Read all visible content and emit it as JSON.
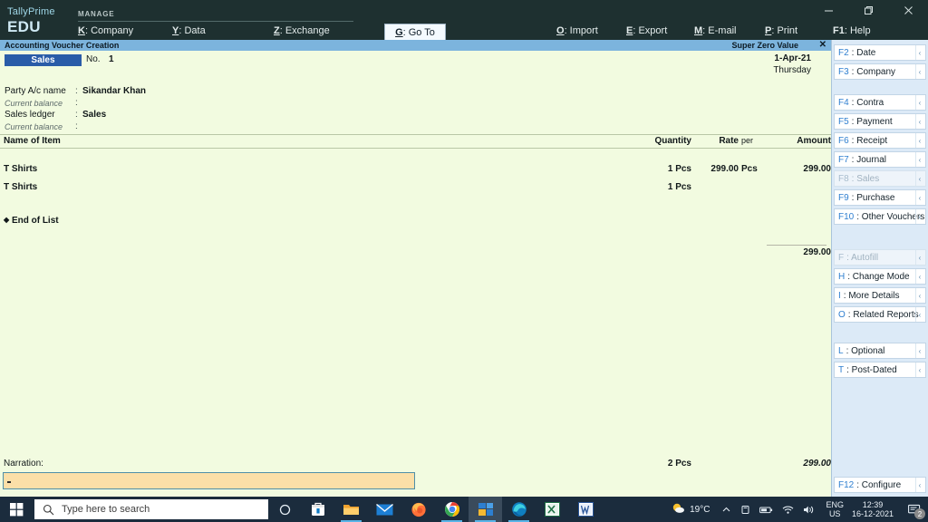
{
  "window": {
    "minimize_icon": "minimize-icon",
    "maximize_icon": "restore-icon",
    "close_icon": "close-icon"
  },
  "brand": {
    "product": "TallyPrime",
    "edition": "EDU"
  },
  "topmenu": {
    "group_label": "MANAGE",
    "items": [
      {
        "key": "K",
        "label": ": Company"
      },
      {
        "key": "Y",
        "label": ": Data"
      },
      {
        "key": "Z",
        "label": ": Exchange"
      }
    ],
    "goto": {
      "key": "G",
      "label": ": Go To"
    },
    "right_items": [
      {
        "key": "O",
        "label": ": Import"
      },
      {
        "key": "E",
        "label": ": Export"
      },
      {
        "key": "M",
        "label": ": E-mail"
      },
      {
        "key": "P",
        "label": ": Print"
      },
      {
        "key": "F1",
        "label": ": Help"
      }
    ]
  },
  "titlestrip": {
    "left": "Accounting Voucher Creation",
    "right": "Super Zero Value",
    "close": "✕"
  },
  "voucher": {
    "type": "Sales",
    "number_label": "No.",
    "number_value": "1",
    "date": "1-Apr-21",
    "weekday": "Thursday",
    "fields": [
      {
        "label": "Party A/c name",
        "colon": ":",
        "value": "Sikandar Khan",
        "italic": false
      },
      {
        "label": "Current balance",
        "colon": ":",
        "value": "",
        "italic": true
      },
      {
        "label": "Sales ledger",
        "colon": ":",
        "value": "Sales",
        "italic": false
      },
      {
        "label": "Current balance",
        "colon": ":",
        "value": "",
        "italic": true
      }
    ]
  },
  "grid": {
    "headers": {
      "item": "Name of Item",
      "quantity": "Quantity",
      "rate": "Rate",
      "per": "per",
      "amount": "Amount"
    },
    "rows": [
      {
        "name": "T Shirts",
        "quantity": "1 Pcs",
        "rate": "299.00",
        "per": "Pcs",
        "amount": "299.00"
      },
      {
        "name": "T Shirts",
        "quantity": "1 Pcs",
        "rate": "",
        "per": "",
        "amount": ""
      }
    ],
    "subtotal": "299.00",
    "end_of_list": "End of List"
  },
  "totals": {
    "quantity": "2 Pcs",
    "amount": "299.00"
  },
  "narration": {
    "label": "Narration:",
    "value": ""
  },
  "sidebar": {
    "groups": [
      {
        "items": [
          {
            "key": "F2",
            "label": ": Date",
            "disabled": false
          },
          {
            "key": "F3",
            "label": ": Company",
            "disabled": false
          }
        ]
      },
      {
        "items": [
          {
            "key": "F4",
            "label": ": Contra",
            "disabled": false
          },
          {
            "key": "F5",
            "label": ": Payment",
            "disabled": false
          },
          {
            "key": "F6",
            "label": ": Receipt",
            "disabled": false
          },
          {
            "key": "F7",
            "label": ": Journal",
            "disabled": false
          },
          {
            "key": "F8",
            "label": ": Sales",
            "disabled": true
          },
          {
            "key": "F9",
            "label": ": Purchase",
            "disabled": false
          },
          {
            "key": "F10",
            "label": ": Other Vouchers",
            "disabled": false
          }
        ]
      },
      {
        "items": [
          {
            "key": "F",
            "label": ": Autofill",
            "disabled": true
          },
          {
            "key": "H",
            "label": ": Change Mode",
            "disabled": false
          },
          {
            "key": "I",
            "label": ": More Details",
            "disabled": false
          },
          {
            "key": "O",
            "label": ": Related Reports",
            "disabled": false
          }
        ]
      },
      {
        "items": [
          {
            "key": "L",
            "label": ": Optional",
            "disabled": false
          },
          {
            "key": "T",
            "label": ": Post-Dated",
            "disabled": false
          }
        ]
      }
    ],
    "bottom": {
      "key": "F12",
      "label": ": Configure",
      "disabled": false
    },
    "chevron": "‹"
  },
  "taskbar": {
    "start_icon": "windows-start-icon",
    "search_placeholder": "Type here to search",
    "cortana_icon": "cortana-icon",
    "apps": [
      {
        "name": "microsoft-store-icon",
        "active": false,
        "open": false
      },
      {
        "name": "file-explorer-icon",
        "active": false,
        "open": true
      },
      {
        "name": "mail-icon",
        "active": false,
        "open": false
      },
      {
        "name": "firefox-icon",
        "active": false,
        "open": false
      },
      {
        "name": "chrome-icon",
        "active": false,
        "open": true
      },
      {
        "name": "tallyprime-icon",
        "active": true,
        "open": true
      },
      {
        "name": "edge-icon",
        "active": false,
        "open": true
      },
      {
        "name": "excel-icon",
        "active": false,
        "open": false
      },
      {
        "name": "word-icon",
        "active": false,
        "open": false
      }
    ],
    "tray": {
      "weather_temp": "19°C",
      "weather_icon": "sun-cloud-icon",
      "overflow_icon": "chevron-up-icon",
      "onedrive_icon": "onedrive-icon",
      "battery_icon": "battery-icon",
      "wifi_icon": "wifi-icon",
      "volume_icon": "volume-icon",
      "lang_line1": "ENG",
      "lang_line2": "US",
      "time": "12:39",
      "date": "16-12-2021",
      "notification_icon": "notification-icon",
      "notification_count": "2"
    }
  }
}
